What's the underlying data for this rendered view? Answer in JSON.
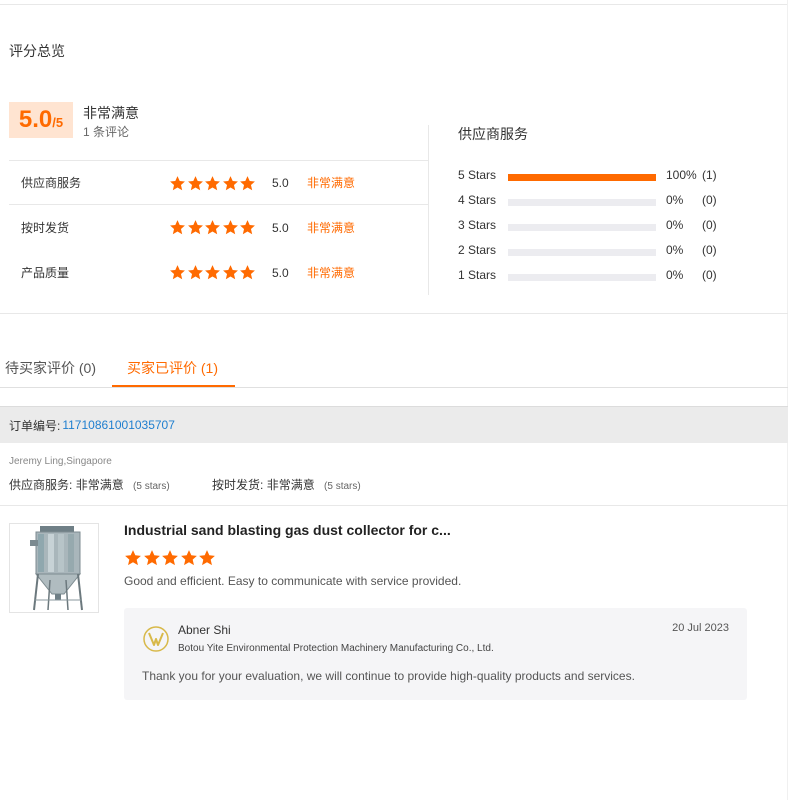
{
  "overview": {
    "title": "评分总览",
    "score": "5.0",
    "score_max": "/5",
    "score_desc": "非常满意",
    "review_count": "1 条评论"
  },
  "ratings": [
    {
      "label": "供应商服务",
      "stars": 5,
      "value": "5.0",
      "quality": "非常满意"
    },
    {
      "label": "按时发货",
      "stars": 5,
      "value": "5.0",
      "quality": "非常满意"
    },
    {
      "label": "产品质量",
      "stars": 5,
      "value": "5.0",
      "quality": "非常满意"
    }
  ],
  "distribution": {
    "title": "供应商服务",
    "rows": [
      {
        "label": "5 Stars",
        "fraction": 1.0,
        "pct": "100%",
        "count": "(1)"
      },
      {
        "label": "4 Stars",
        "fraction": 0,
        "pct": "0%",
        "count": "(0)"
      },
      {
        "label": "3 Stars",
        "fraction": 0,
        "pct": "0%",
        "count": "(0)"
      },
      {
        "label": "2 Stars",
        "fraction": 0,
        "pct": "0%",
        "count": "(0)"
      },
      {
        "label": "1 Stars",
        "fraction": 0,
        "pct": "0%",
        "count": "(0)"
      }
    ],
    "bar_color": "#ff6a00",
    "track_color": "#ececf0"
  },
  "tabs": [
    {
      "label": "待买家评价 (0)",
      "active": false
    },
    {
      "label": "买家已评价 (1)",
      "active": true
    }
  ],
  "order": {
    "label": "订单编号:",
    "number": "11710861001035707"
  },
  "buyer": {
    "name": "Jeremy Ling,Singapore",
    "supplier_label": "供应商服务:",
    "supplier_value": "非常满意",
    "supplier_stars": "(5 stars)",
    "shipping_label": "按时发货:",
    "shipping_value": "非常满意",
    "shipping_stars": "(5 stars)"
  },
  "review": {
    "product_title": "Industrial sand blasting gas dust collector for c...",
    "stars": 5,
    "text": "Good and efficient. Easy to communicate with service provided.",
    "thumbnail_icon": "dust-collector-product-image"
  },
  "reply": {
    "name": "Abner Shi",
    "company": "Botou Yite Environmental Protection Machinery Manufacturing Co., Ltd.",
    "date": "20 Jul 2023",
    "text": "Thank you for your evaluation, we will continue to provide high-quality products and services.",
    "logo_icon": "company-logo-icon"
  },
  "colors": {
    "accent": "#ff6a00",
    "link": "#1f7fcf",
    "score_bg": "#ffe4d1"
  }
}
